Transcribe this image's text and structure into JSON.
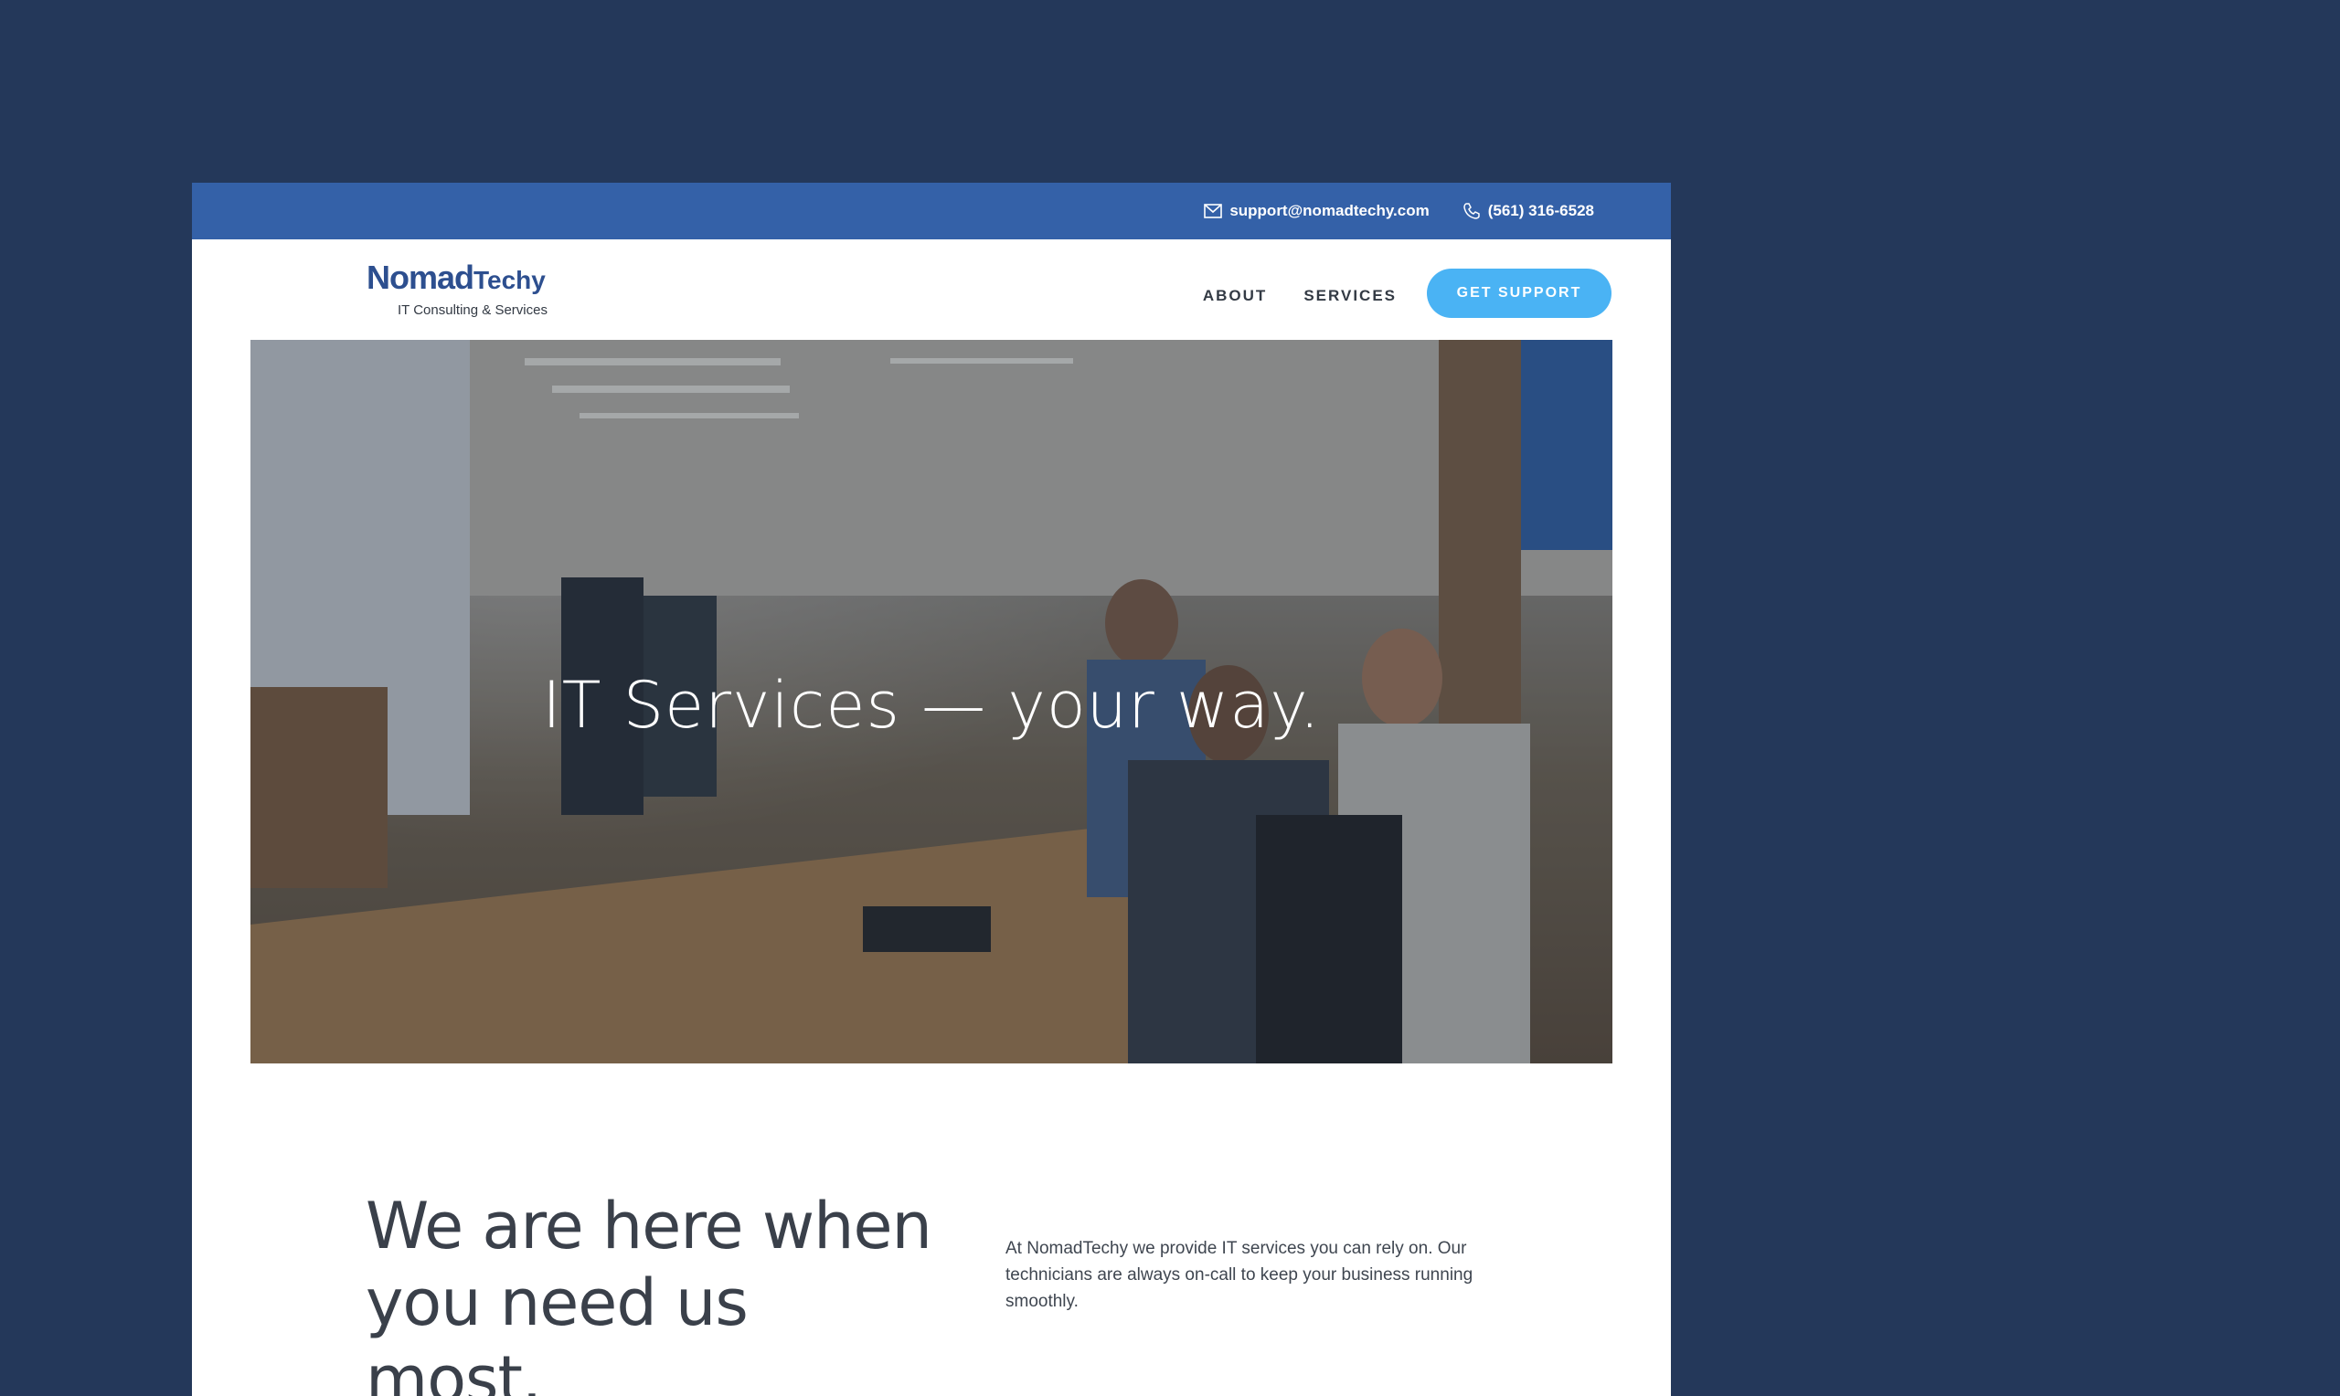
{
  "topbar": {
    "email": "support@nomadtechy.com",
    "phone": "(561) 316-6528",
    "email_icon": "envelope-icon",
    "phone_icon": "phone-icon"
  },
  "brand": {
    "name_part1": "Nomad",
    "name_part2": "Techy",
    "tagline": "IT Consulting & Services"
  },
  "nav": {
    "items": [
      {
        "label": "ABOUT"
      },
      {
        "label": "SERVICES"
      }
    ],
    "cta_label": "GET SUPPORT"
  },
  "hero": {
    "title": "IT Services  —  your way."
  },
  "intro": {
    "heading": "We are here when you need us most.",
    "body": "At NomadTechy we provide IT services you can rely on. Our technicians are always on-call to keep your business running smoothly."
  },
  "colors": {
    "background": "#24385a",
    "topbar": "#3461a8",
    "brand": "#2d4f8f",
    "cta": "#4ab3f4",
    "text": "#333a44"
  }
}
